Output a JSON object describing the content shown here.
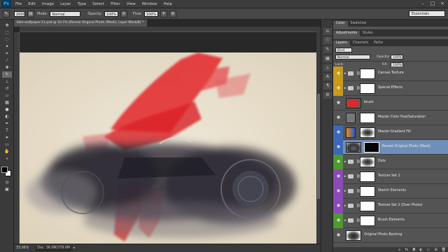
{
  "app": {
    "logo": "Ps"
  },
  "menu": [
    "File",
    "Edit",
    "Image",
    "Layer",
    "Type",
    "Select",
    "Filter",
    "View",
    "Window",
    "Help"
  ],
  "options_bar": {
    "brush_size": "2000",
    "mode_label": "Mode:",
    "mode_value": "Normal",
    "opacity_label": "Opacity:",
    "opacity_value": "100%",
    "flow_label": "Flow:",
    "flow_value": "100%",
    "workspace": "Essentials"
  },
  "document": {
    "tab_title": "bike-wallpaper-11.psd @ 33.1% (Reveal Original Photo (Mask), Layer Mask/8) *",
    "zoom": "33.06%",
    "doc_info": "Doc: 36.0M/379.6M"
  },
  "panels": {
    "top_tabs": [
      "Color",
      "Swatches"
    ],
    "mid_tabs": [
      "Adjustments",
      "Styles"
    ],
    "layer_tabs": [
      "Layers",
      "Channels",
      "Paths"
    ],
    "kind_label": "Kind",
    "blend_mode": "Normal",
    "opacity_label": "Opacity:",
    "opacity_value": "100%",
    "lock_label": "Lock:",
    "fill_label": "Fill:",
    "fill_value": "100%"
  },
  "layers": [
    {
      "name": "Canvas Texture",
      "type": "group",
      "tag": "#c79a17",
      "thumb": "white"
    },
    {
      "name": "Special Effects",
      "type": "group",
      "tag": "#c79a17",
      "thumb": "white"
    },
    {
      "name": "brush",
      "type": "layer",
      "tag": "",
      "thumb": "red"
    },
    {
      "name": "Master Color Hue/Saturation",
      "type": "adjustment",
      "tag": "",
      "thumb": "white"
    },
    {
      "name": "Master Gradient Fill",
      "type": "adjustment",
      "tag": "#3c68b8",
      "thumb": "cloud"
    },
    {
      "name": "Reveal Original Photo (Mask)",
      "type": "layer",
      "tag": "#3c68b8",
      "thumb": "black",
      "selected": true
    },
    {
      "name": "Dots",
      "type": "group",
      "tag": "#4e9a2e",
      "thumb": "cloud"
    },
    {
      "name": "Texture Set 1",
      "type": "group",
      "tag": "#8a4bb6",
      "thumb": "white"
    },
    {
      "name": "Sketch Elements",
      "type": "group",
      "tag": "#8a4bb6",
      "thumb": "white"
    },
    {
      "name": "Texture Set 2 (Over Photo)",
      "type": "group",
      "tag": "#8a4bb6",
      "thumb": "white"
    },
    {
      "name": "Brush Elements",
      "type": "group",
      "tag": "#4e9a2e",
      "thumb": "white"
    },
    {
      "name": "Original Photo Backing",
      "type": "layer",
      "tag": "",
      "thumb": "bike"
    }
  ],
  "colors": {
    "accent_selected": "#6f8fb9",
    "red_paint": "#e3262a",
    "paper": "#e8e0cf"
  }
}
